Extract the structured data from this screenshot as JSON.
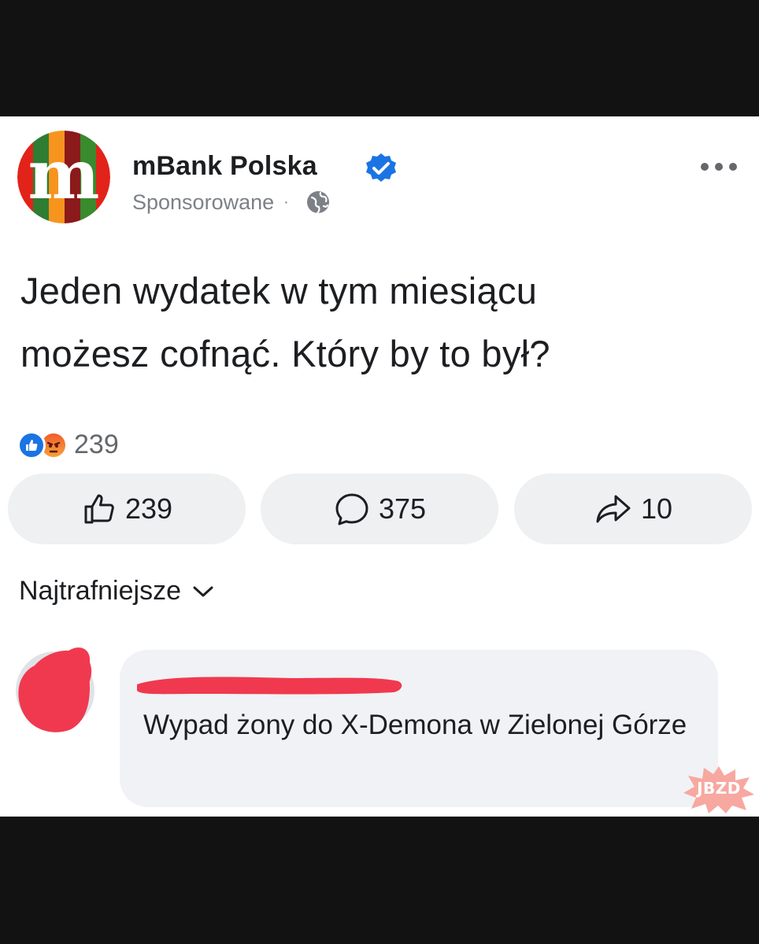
{
  "post": {
    "page_name": "mBank Polska",
    "sponsored_label": "Sponsorowane",
    "meta_separator": "·",
    "text_line1": "Jeden wydatek w tym miesiącu",
    "text_line2": "możesz cofnąć. Który by to był?"
  },
  "logo": {
    "letter": "m"
  },
  "reactions": {
    "types": [
      "like-icon",
      "angry-icon"
    ],
    "count": "239"
  },
  "actions": {
    "like_count": "239",
    "comment_count": "375",
    "share_count": "10"
  },
  "comments": {
    "sort_label": "Najtrafniejsze",
    "items": [
      {
        "author_redacted": true,
        "text": "Wypad żony do X-Demona w Zielonej Górze"
      }
    ]
  },
  "watermark": {
    "text": "JBZD"
  },
  "colors": {
    "verified_blue": "#1b74e4",
    "button_bg": "#eef0f2",
    "bubble_bg": "#f0f2f5",
    "redaction_red": "#f0394f",
    "secondary_text": "#7d8187"
  }
}
